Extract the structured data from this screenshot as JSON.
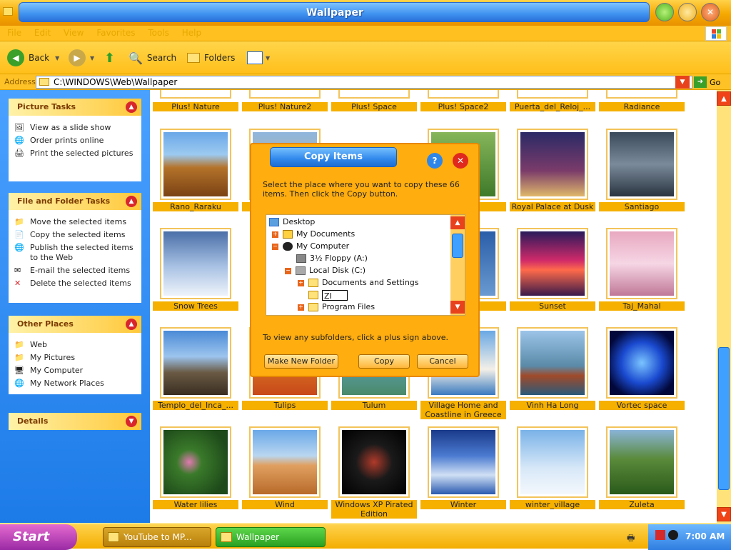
{
  "window": {
    "title": "Wallpaper"
  },
  "menu": [
    "File",
    "Edit",
    "View",
    "Favorites",
    "Tools",
    "Help"
  ],
  "toolbar": {
    "back": "Back",
    "search": "Search",
    "folders": "Folders"
  },
  "address": {
    "label": "Address",
    "path": "C:\\WINDOWS\\Web\\Wallpaper",
    "go": "Go"
  },
  "panels": {
    "picture_tasks": {
      "title": "Picture Tasks",
      "items": [
        "View as a slide show",
        "Order prints online",
        "Print the selected pictures"
      ]
    },
    "file_tasks": {
      "title": "File and Folder Tasks",
      "items": [
        "Move the selected items",
        "Copy the selected items",
        "Publish the selected items to the Web",
        "E-mail the selected items",
        "Delete the selected items"
      ]
    },
    "other_places": {
      "title": "Other Places",
      "items": [
        "Web",
        "My Pictures",
        "My Computer",
        "My Network Places"
      ]
    },
    "details": {
      "title": "Details"
    }
  },
  "thumbs": {
    "row0": [
      "Plus! Nature",
      "Plus! Nature2",
      "Plus! Space",
      "Plus! Space2",
      "Puerta_del_Reloj_...",
      "Radiance"
    ],
    "row1": [
      "Rano_Raraku",
      "R",
      "",
      "guay",
      "Royal Palace at Dusk",
      "Santiago"
    ],
    "row2": [
      "Snow Trees",
      "",
      "",
      "ntain",
      "Sunset",
      "Taj_Mahal"
    ],
    "row3": [
      "Templo_del_Inca_...",
      "Tulips",
      "Tulum",
      "Village Home and Coastline in Greece",
      "Vinh Ha Long",
      "Vortec space"
    ],
    "row4": [
      "Water lilies",
      "Wind",
      "Windows XP Pirated Edition",
      "Winter",
      "winter_village",
      "Zuleta"
    ]
  },
  "dialog": {
    "title": "Copy Items",
    "instruction": "Select the place where you want to copy these 66 items. Then click the Copy button.",
    "tree": [
      "Desktop",
      "My Documents",
      "My Computer",
      "3½ Floppy (A:)",
      "Local Disk (C:)",
      "Documents and Settings",
      "ZI",
      "Program Files"
    ],
    "hint": "To view any subfolders, click a plus sign above.",
    "buttons": {
      "new_folder": "Make New Folder",
      "copy": "Copy",
      "cancel": "Cancel"
    }
  },
  "taskbar": {
    "start": "Start",
    "tasks": [
      "YouTube to MP...",
      "Wallpaper"
    ],
    "clock": "7:00 AM"
  }
}
